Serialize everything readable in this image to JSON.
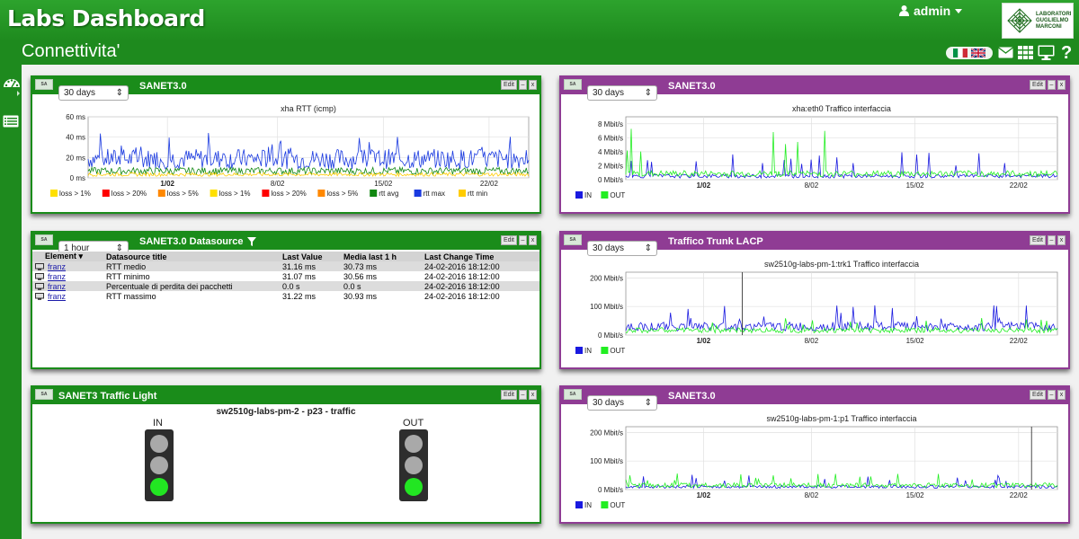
{
  "app": {
    "title": "Labs Dashboard",
    "user": "admin",
    "page_title": "Connettivita'"
  },
  "logo": {
    "line1": "LABORATORI",
    "line2": "GUGLIELMO",
    "line3": "MARCONI"
  },
  "toolbar": {
    "icons": [
      "mail-icon",
      "grid-icon",
      "monitor-icon",
      "help-icon"
    ]
  },
  "controls": {
    "edit": "Edit",
    "minimize": "–",
    "close": "x"
  },
  "colors": {
    "green": "#1a8c1a",
    "purple": "#8f3c94",
    "in": "#1a1ae0",
    "out": "#22ee22"
  },
  "panels": {
    "p1": {
      "select": "30 days",
      "title": "SANET3.0"
    },
    "p2": {
      "select": "30 days",
      "title": "SANET3.0"
    },
    "p3": {
      "select": "1 hour",
      "title": "SANET3.0 Datasource"
    },
    "p4": {
      "select": "30 days",
      "title": "Traffico Trunk LACP"
    },
    "p5": {
      "title": "SANET3 Traffic Light"
    },
    "p6": {
      "select": "30 days",
      "title": "SANET3.0"
    }
  },
  "datasource_table": {
    "headers": [
      "Element",
      "Datasource title",
      "Last Value",
      "Media last 1 h",
      "Last Change Time"
    ],
    "rows": [
      [
        "franz",
        "RTT medio",
        "31.16 ms",
        "30.73 ms",
        "24-02-2016 18:12:00"
      ],
      [
        "franz",
        "RTT minimo",
        "31.07 ms",
        "30.56 ms",
        "24-02-2016 18:12:00"
      ],
      [
        "franz",
        "Percentuale di perdita dei pacchetti",
        "0.0 s",
        "0.0 s",
        "24-02-2016 18:12:00"
      ],
      [
        "franz",
        "RTT massimo",
        "31.22 ms",
        "30.93 ms",
        "24-02-2016 18:12:00"
      ]
    ]
  },
  "traffic_light": {
    "title": "sw2510g-labs-pm-2 - p23 - traffic",
    "in_label": "IN",
    "out_label": "OUT",
    "in_state": "green",
    "out_state": "green"
  },
  "chart_data": [
    {
      "type": "line",
      "title": "xha RTT (icmp)",
      "ylabel": "",
      "ylim": [
        0,
        60
      ],
      "yticks": [
        "0 ms",
        "20 ms",
        "40 ms",
        "60 ms"
      ],
      "xticks": [
        "1/02",
        "8/02",
        "15/02",
        "22/02"
      ],
      "legend": [
        {
          "label": "loss > 1%",
          "color": "#ffe000"
        },
        {
          "label": "loss > 20%",
          "color": "#ff0000"
        },
        {
          "label": "loss > 5%",
          "color": "#ff8800"
        },
        {
          "label": "loss > 1%",
          "color": "#ffe000"
        },
        {
          "label": "loss > 20%",
          "color": "#ff0000"
        },
        {
          "label": "loss > 5%",
          "color": "#ff8800"
        },
        {
          "label": "rtt avg",
          "color": "#118811"
        },
        {
          "label": "rtt max",
          "color": "#1a3ae0"
        },
        {
          "label": "rtt min",
          "color": "#ffcc00"
        }
      ],
      "series": [
        {
          "name": "rtt max",
          "typical": 22,
          "spikes": 45
        },
        {
          "name": "rtt avg",
          "typical": 8
        },
        {
          "name": "rtt min",
          "typical": 4
        }
      ]
    },
    {
      "type": "line",
      "title": "xha:eth0 Traffico interfaccia",
      "ylabel": "",
      "ylim": [
        0,
        9
      ],
      "yticks": [
        "0 Mbit/s",
        "2 Mbit/s",
        "4 Mbit/s",
        "6 Mbit/s",
        "8 Mbit/s"
      ],
      "xticks": [
        "1/02",
        "8/02",
        "15/02",
        "22/02"
      ],
      "legend": [
        {
          "label": "IN",
          "color": "#1a1ae0"
        },
        {
          "label": "OUT",
          "color": "#22ee22"
        }
      ],
      "series": [
        {
          "name": "IN",
          "typical": 0.6,
          "spikes": 4
        },
        {
          "name": "OUT",
          "typical": 1,
          "spikes": 7.5
        }
      ]
    },
    {
      "type": "line",
      "title": "sw2510g-labs-pm-1:trk1 Traffico interfaccia",
      "ylabel": "",
      "ylim": [
        0,
        220
      ],
      "yticks": [
        "0 Mbit/s",
        "100 Mbit/s",
        "200 Mbit/s"
      ],
      "xticks": [
        "1/02",
        "8/02",
        "15/02",
        "22/02"
      ],
      "legend": [
        {
          "label": "IN",
          "color": "#1a1ae0"
        },
        {
          "label": "OUT",
          "color": "#22ee22"
        }
      ],
      "series": [
        {
          "name": "IN",
          "typical": 35,
          "spikes": 110
        },
        {
          "name": "OUT",
          "typical": 20,
          "spikes": 60
        }
      ]
    },
    {
      "type": "line",
      "title": "sw2510g-labs-pm-1:p1 Traffico interfaccia",
      "ylabel": "",
      "ylim": [
        0,
        220
      ],
      "yticks": [
        "0 Mbit/s",
        "100 Mbit/s",
        "200 Mbit/s"
      ],
      "xticks": [
        "1/02",
        "8/02",
        "15/02",
        "22/02"
      ],
      "legend": [
        {
          "label": "IN",
          "color": "#1a1ae0"
        },
        {
          "label": "OUT",
          "color": "#22ee22"
        }
      ],
      "series": [
        {
          "name": "IN",
          "typical": 12,
          "spikes": 55
        },
        {
          "name": "OUT",
          "typical": 18,
          "spikes": 60
        }
      ]
    }
  ]
}
